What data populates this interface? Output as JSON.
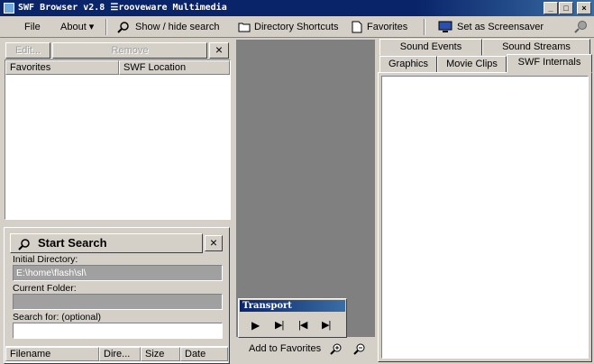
{
  "window": {
    "title": "SWF Browser v2.8  ☰rooveware Multimedia",
    "minimize_glyph": "_",
    "maximize_glyph": "□",
    "close_glyph": "×"
  },
  "menu": {
    "file": "File",
    "about": "About ▾",
    "show_hide_search": "Show / hide search",
    "directory_shortcuts": "Directory Shortcuts",
    "favorites": "Favorites",
    "set_screensaver": "Set as Screensaver"
  },
  "favorites_panel": {
    "edit_label": "Edit...",
    "remove_label": "Remove",
    "close_glyph": "×",
    "columns": [
      "Favorites",
      "SWF Location"
    ]
  },
  "search_panel": {
    "start_search_label": "Start Search",
    "close_glyph": "×",
    "initial_directory_label": "Initial Directory:",
    "initial_directory_value": "E:\\home\\flash\\sl\\",
    "current_folder_label": "Current Folder:",
    "current_folder_value": "",
    "search_for_label": "Search for: (optional)",
    "search_for_value": "",
    "columns": [
      "Filename",
      "Dire...",
      "Size",
      "Date"
    ]
  },
  "transport": {
    "title": "Transport",
    "play": "▶",
    "step_forward": "▶|",
    "rewind": "|◀",
    "go_to_end": "▶|"
  },
  "center_footer": {
    "add_to_favorites": "Add to Favorites"
  },
  "tabs": {
    "row_back": [
      "Sound Events",
      "Sound Streams"
    ],
    "row_front": [
      "Graphics",
      "Movie Clips",
      "SWF Internals"
    ],
    "active": "SWF Internals"
  },
  "colors": {
    "titlebar": "#0a246a",
    "face": "#d4d0c8",
    "center_area": "#808080"
  }
}
